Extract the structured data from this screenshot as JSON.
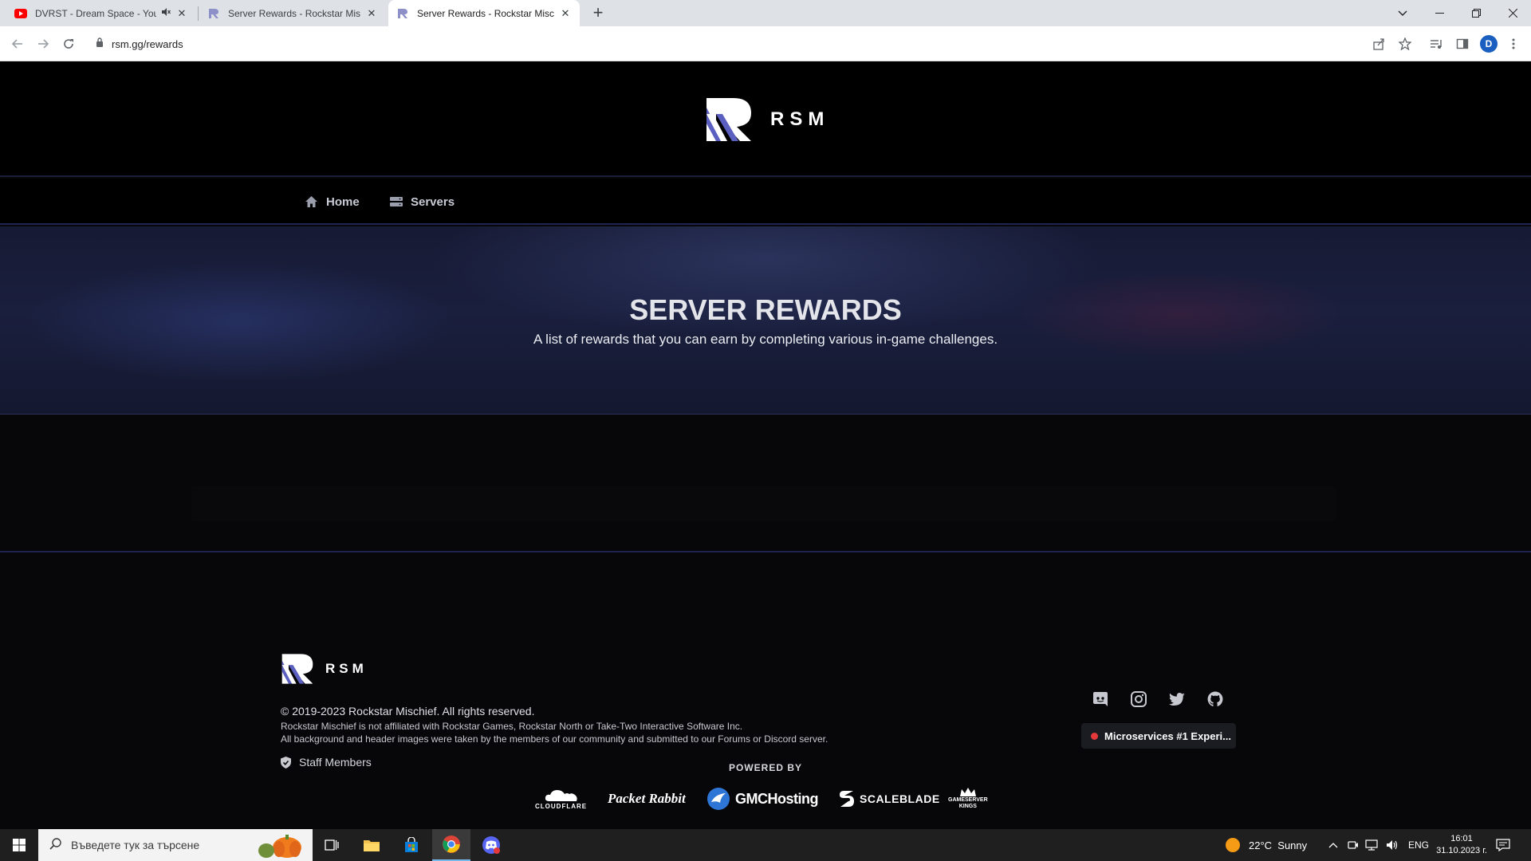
{
  "browser": {
    "tabs": [
      {
        "title": "DVRST - Dream Space - You",
        "favicon": "youtube-icon",
        "audio": "mute-icon"
      },
      {
        "title": "Server Rewards - Rockstar Misch",
        "favicon": "rsm-icon"
      },
      {
        "title": "Server Rewards - Rockstar Misch",
        "favicon": "rsm-icon",
        "active": true
      }
    ],
    "url": "rsm.gg/rewards",
    "profile_initial": "D"
  },
  "site": {
    "logo_text": "RSM",
    "nav": [
      {
        "label": "Home",
        "icon": "home-icon"
      },
      {
        "label": "Servers",
        "icon": "servers-icon"
      }
    ],
    "hero": {
      "title": "SERVER REWARDS",
      "subtitle": "A list of rewards that you can earn by completing various in-game challenges."
    },
    "footer": {
      "logo_text": "RSM",
      "copyright": "© 2019-2023 Rockstar Mischief. All rights reserved.",
      "disclaimer_1": "Rockstar Mischief is not affiliated with Rockstar Games, Rockstar North or Take-Two Interactive Software Inc.",
      "disclaimer_2": "All background and header images were taken by the members of our community and submitted to our Forums or Discord server.",
      "staff_link": "Staff Members",
      "socials": [
        "discord-icon",
        "instagram-icon",
        "twitter-icon",
        "github-icon"
      ],
      "now_playing": "Microservices #1 Experi...",
      "powered_by": "POWERED BY",
      "partners": {
        "cloudflare": "CLOUDFLARE",
        "packet_rabbit": "Packet Rabbit",
        "gmc": "GMCHosting",
        "scaleblade": "SCALEBLADE",
        "gsk_1": "GAMESERVER",
        "gsk_2": "KINGS"
      }
    }
  },
  "taskbar": {
    "search_placeholder": "Въведете тук за търсене",
    "weather": "22°C  Sunny",
    "language": "ENG",
    "time": "16:01",
    "date": "31.10.2023 г."
  },
  "colors": {
    "site_bg": "#070709",
    "accent_line": "#202453",
    "hero_bg": "#1a1f3e",
    "live_dot": "#e5383b"
  }
}
